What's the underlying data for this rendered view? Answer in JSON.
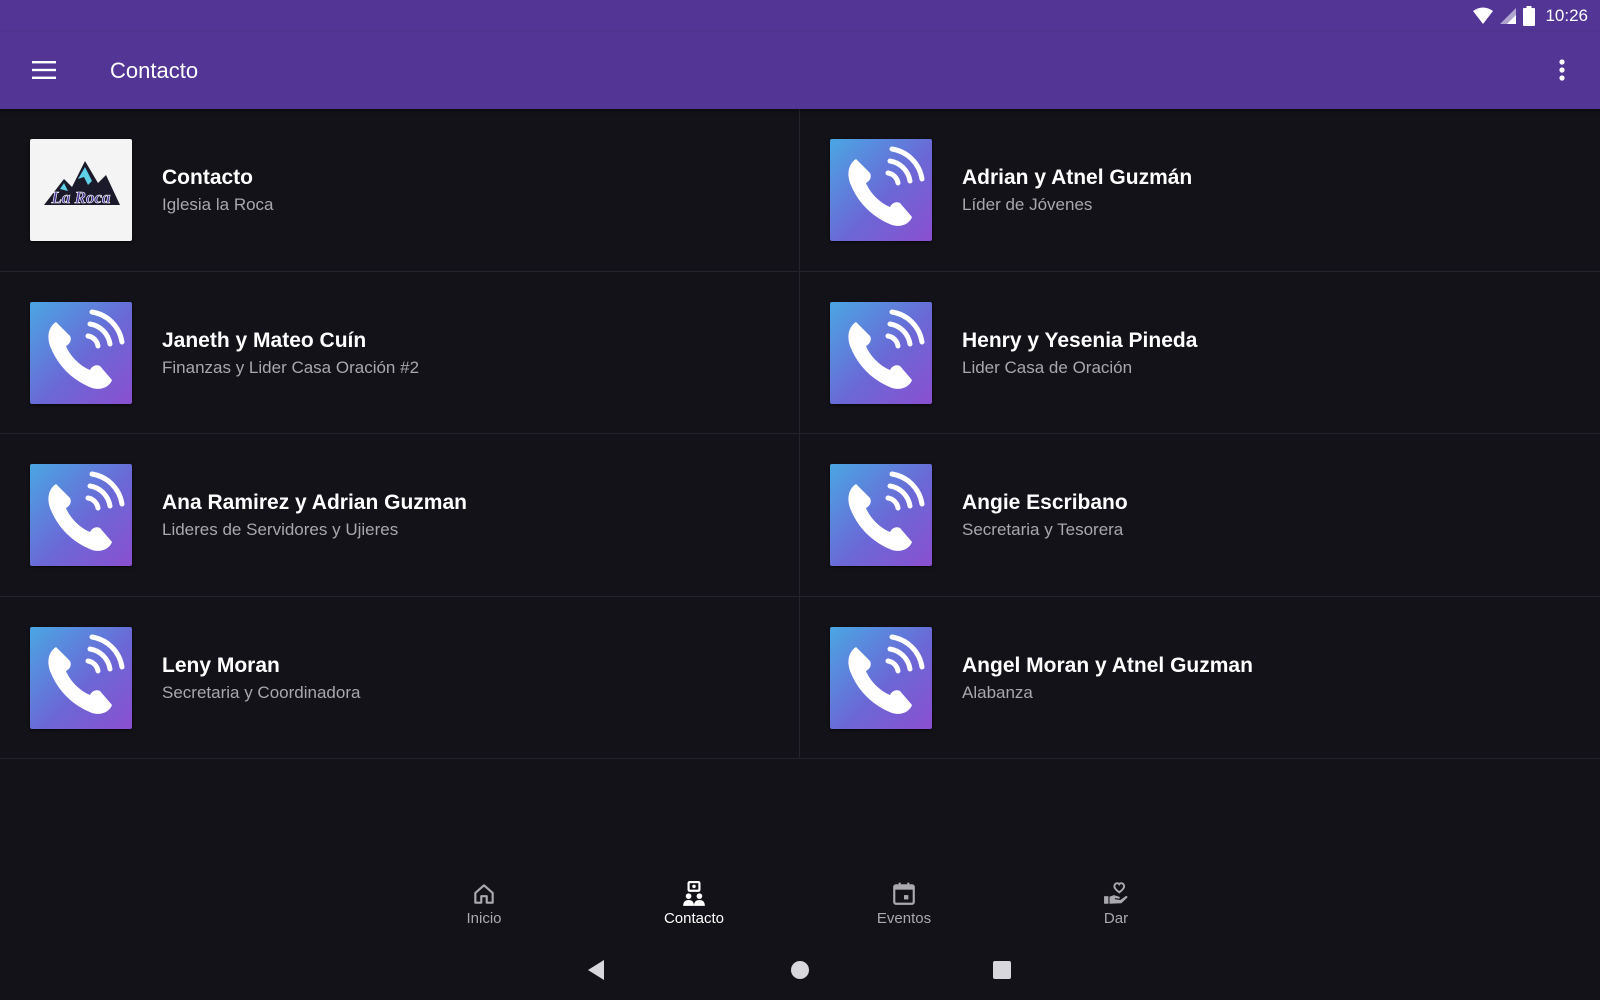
{
  "status_bar": {
    "time": "10:26",
    "icons": [
      "wifi-icon",
      "signal-icon",
      "battery-icon"
    ]
  },
  "app_bar": {
    "title": "Contacto",
    "menu_icon": "menu-icon",
    "overflow_icon": "more-vert-icon"
  },
  "contacts": [
    {
      "name": "Contacto",
      "role": "Iglesia la Roca",
      "thumbnail": "church-logo"
    },
    {
      "name": "Adrian y Atnel Guzmán",
      "role": "Líder de Jóvenes",
      "thumbnail": "phone-icon"
    },
    {
      "name": "Janeth y Mateo Cuín",
      "role": "Finanzas y Lider Casa Oración #2",
      "thumbnail": "phone-icon"
    },
    {
      "name": "Henry y Yesenia Pineda",
      "role": "Lider Casa de Oración",
      "thumbnail": "phone-icon"
    },
    {
      "name": "Ana Ramirez y Adrian Guzman",
      "role": "Lideres de Servidores y Ujieres",
      "thumbnail": "phone-icon"
    },
    {
      "name": "Angie Escribano",
      "role": "Secretaria y Tesorera",
      "thumbnail": "phone-icon"
    },
    {
      "name": "Leny Moran",
      "role": "Secretaria y Coordinadora",
      "thumbnail": "phone-icon"
    },
    {
      "name": "Angel Moran y Atnel Guzman",
      "role": "Alabanza",
      "thumbnail": "phone-icon"
    }
  ],
  "logo": {
    "text": "La Roca"
  },
  "bottom_nav": {
    "active": "Contacto",
    "items": [
      {
        "label": "Inicio",
        "icon": "home-icon"
      },
      {
        "label": "Contacto",
        "icon": "contacts-icon"
      },
      {
        "label": "Eventos",
        "icon": "calendar-icon"
      },
      {
        "label": "Dar",
        "icon": "give-heart-icon"
      }
    ]
  },
  "system_nav": [
    "back-icon",
    "home-circle-icon",
    "recents-icon"
  ],
  "colors": {
    "primary": "#533595",
    "background": "#121218",
    "divider": "#24242c",
    "subtitle": "#a7a7ad"
  }
}
